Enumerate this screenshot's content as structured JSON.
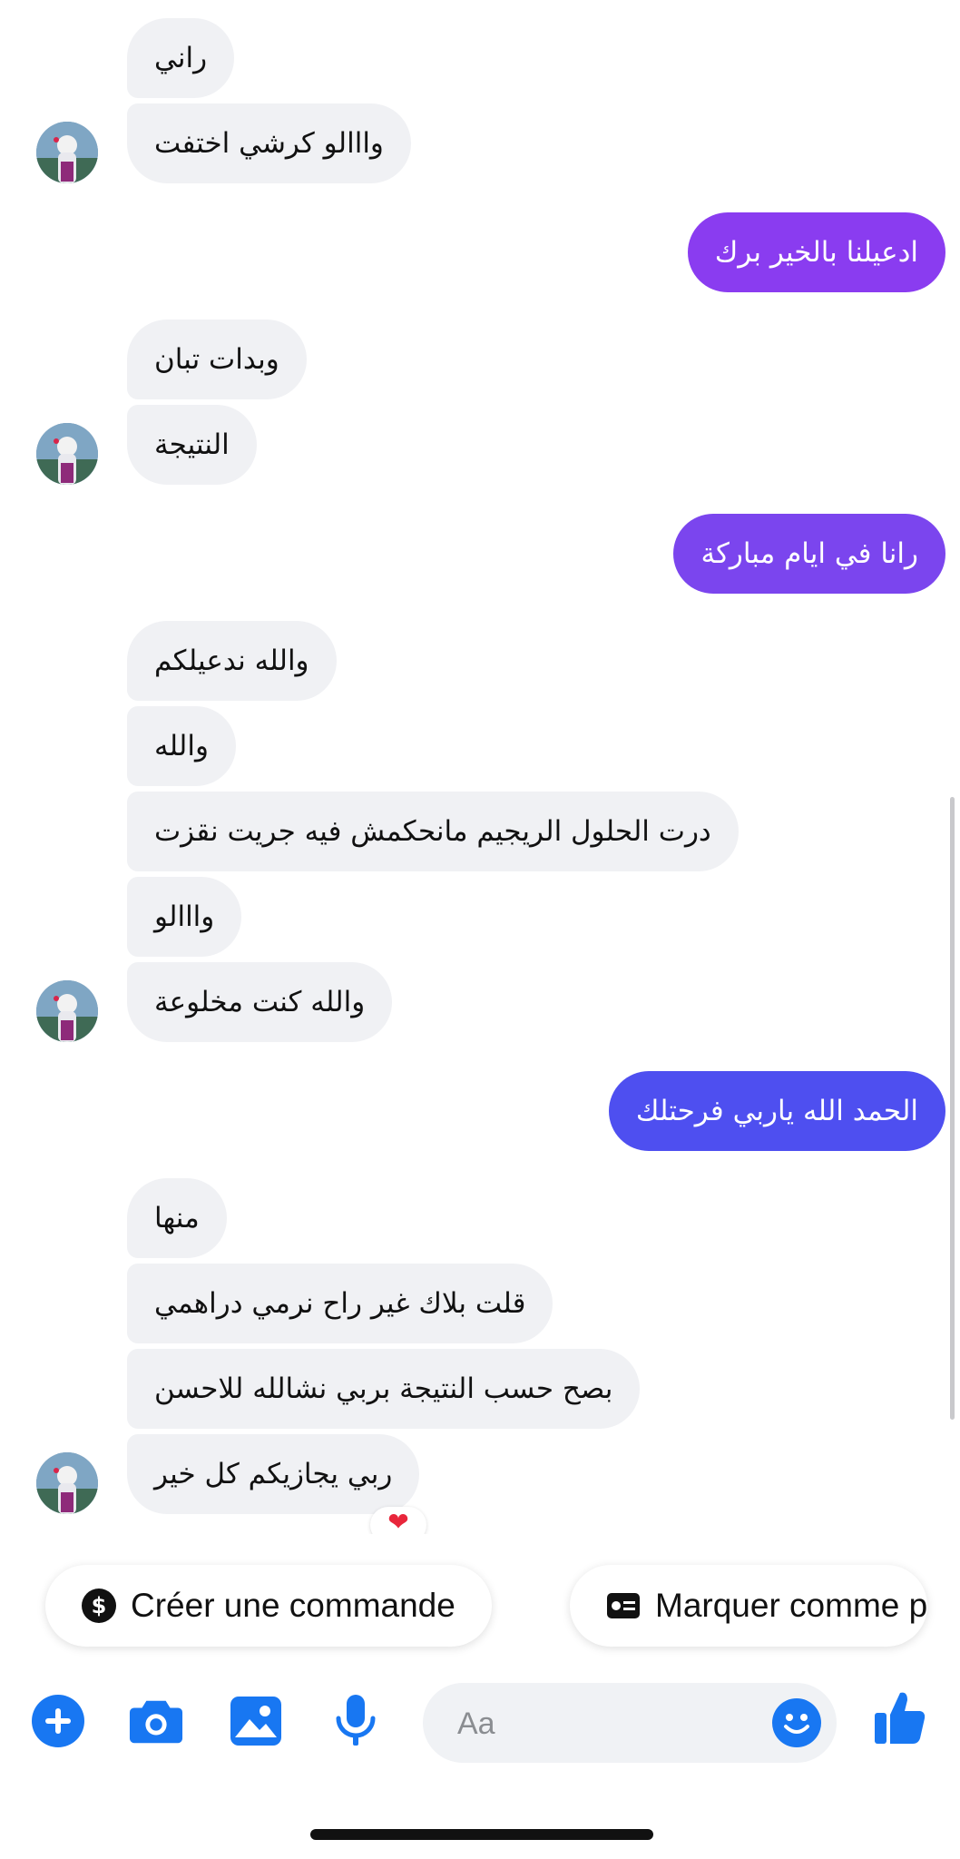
{
  "colors": {
    "incoming_bg": "#f0f1f4",
    "outgoing_purple": "#8a3cf0",
    "outgoing_violet": "#7b45ee",
    "outgoing_blue": "#4e4ff0",
    "accent": "#1877f2"
  },
  "messages": [
    {
      "side": "in",
      "text": "راني"
    },
    {
      "side": "in",
      "text": "وااالو كرشي اختفت"
    },
    {
      "side": "out",
      "text": "ادعيلنا بالخير برك"
    },
    {
      "side": "in",
      "text": "وبدات تبان"
    },
    {
      "side": "in",
      "text": "النتيجة"
    },
    {
      "side": "out",
      "text": "رانا في ايام مباركة"
    },
    {
      "side": "in",
      "text": "والله ندعيلكم"
    },
    {
      "side": "in",
      "text": "والله"
    },
    {
      "side": "in",
      "text": "درت الحلول الريجيم مانحكمش فيه جريت نقزت"
    },
    {
      "side": "in",
      "text": "وااالو"
    },
    {
      "side": "in",
      "text": "والله كنت مخلوعة"
    },
    {
      "side": "out",
      "text": "الحمد الله ياربي فرحتلك"
    },
    {
      "side": "in",
      "text": "منها"
    },
    {
      "side": "in",
      "text": "قلت بلاك غير راح نرمي دراهمي"
    },
    {
      "side": "in",
      "text": "بصح حسب النتيجة بربي نشالله للاحسن"
    },
    {
      "side": "in",
      "text": "ربي يجازيكم كل خير"
    }
  ],
  "reaction": {
    "icon": "heart-icon",
    "glyph": "❤"
  },
  "quick_actions": [
    {
      "label": "Créer une commande",
      "icon": "dollar-icon"
    },
    {
      "label": "Marquer comme p",
      "icon": "id-card-icon"
    }
  ],
  "composer": {
    "placeholder": "Aa"
  },
  "toolbar": {
    "icons": [
      "plus-icon",
      "camera-icon",
      "gallery-icon",
      "microphone-icon",
      "emoji-icon",
      "thumbs-up-icon"
    ]
  }
}
